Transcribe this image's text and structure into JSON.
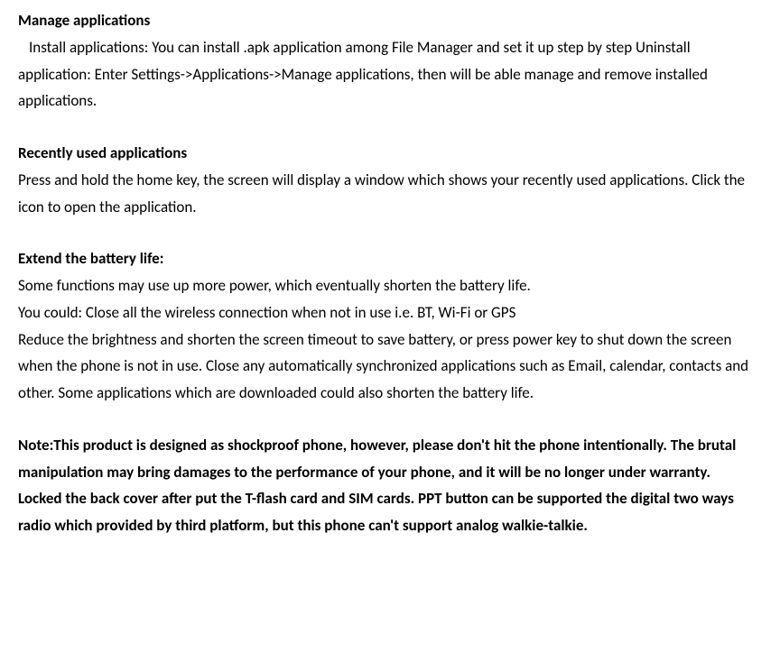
{
  "sections": {
    "manage_apps": {
      "heading": "Manage applications",
      "body": "  Install applications: You can install .apk application among File Manager and set it up step by step Uninstall application: Enter Settings->Applications->Manage applications, then will be able manage and remove installed applications."
    },
    "recent_apps": {
      "heading": "Recently used applications",
      "body": "Press and hold the home key, the screen will display a window which shows your recently used applications. Click the icon to open the application."
    },
    "battery": {
      "heading": "Extend the battery life:",
      "body1": "Some functions may use up more power, which eventually shorten the battery life.",
      "body2": "You could: Close all the wireless connection when not in use i.e. BT, Wi-Fi or GPS",
      "body3": "Reduce the brightness and shorten the screen timeout to save battery, or press power key to shut down the screen when the phone is not in use. Close any automatically synchronized applications such as Email, calendar, contacts and other. Some applications which are downloaded could also shorten the battery life."
    },
    "note": {
      "body": "Note:This product is designed as shockproof phone, however, please don't hit the phone intentionally. The brutal manipulation may bring damages to the performance of your phone, and it will be no longer under warranty.",
      "body2": "Locked the back cover after put the T-flash card and SIM cards. PPT button can be supported the digital two ways radio which provided by third platform, but this phone can't support analog walkie-talkie."
    }
  }
}
